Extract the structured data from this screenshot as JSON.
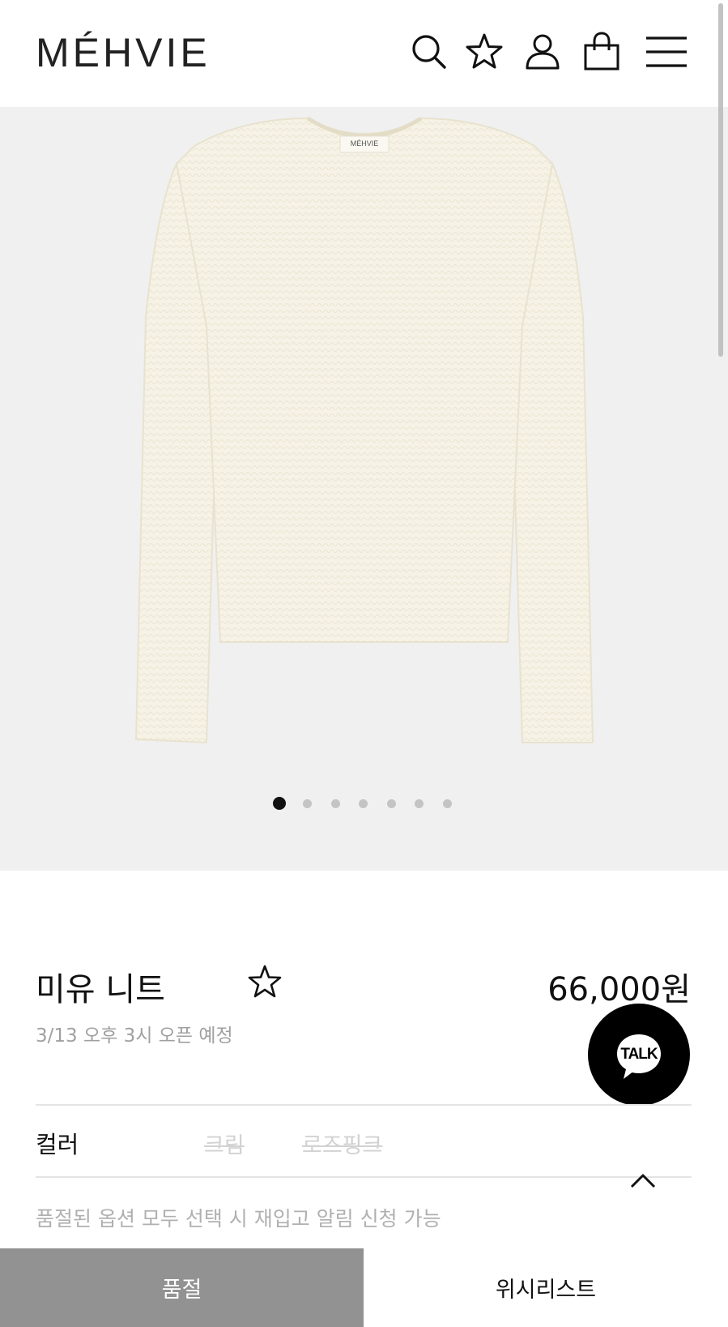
{
  "header": {
    "logo": "MÉHVIE",
    "icons": [
      "search-icon",
      "star-icon",
      "user-icon",
      "shopping-bag-icon",
      "menu-icon"
    ]
  },
  "gallery": {
    "label_text": "MÉHVIE",
    "slide_count": 7,
    "active_slide": 1,
    "background_color": "#f0f0f0",
    "sweater_color": "#f6f2e5"
  },
  "product": {
    "name": "미유 니트",
    "price": "66,000원",
    "note": "3/13 오후 3시 오픈 예정"
  },
  "talk_button": {
    "label": "TALK"
  },
  "options": {
    "label": "컬러",
    "values": [
      "크림",
      "로즈핑크"
    ],
    "restock_note": "품절된 옵션 모두 선택 시 재입고 알림 신청 가능"
  },
  "bottom_bar": {
    "soldout_label": "품절",
    "wishlist_label": "위시리스트",
    "soldout_color": "#929292"
  }
}
